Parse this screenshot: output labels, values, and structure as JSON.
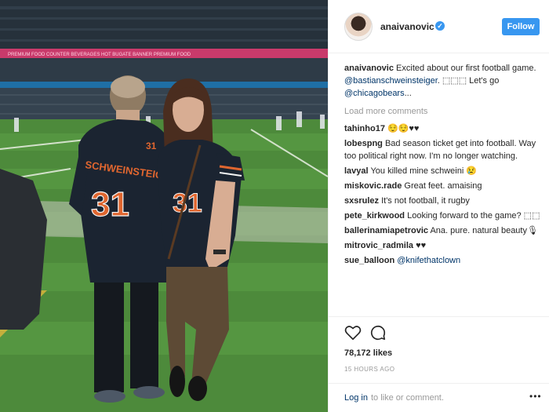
{
  "post": {
    "username": "anaivanovic",
    "follow_label": "Follow",
    "caption": {
      "user": "anaivanovic",
      "text": " Excited about our first football game. ",
      "mention1": "@bastianschweinsteiger",
      "text2": ". ⬚⬚⬚ Let's go ",
      "mention2": "@chicagobears",
      "text3": "..."
    },
    "load_more": "Load more comments",
    "comments": [
      {
        "user": "tahinho17",
        "text": " 😌😌♥♥"
      },
      {
        "user": "lobespng",
        "text": " Bad season ticket get into football. Way too political right now. I'm no longer watching."
      },
      {
        "user": "lavyal",
        "text": " You killed mine schweini 😢"
      },
      {
        "user": "miskovic.rade",
        "text": " Great feet. amaising"
      },
      {
        "user": "sxsrulez",
        "text": " It's not football, it rugby"
      },
      {
        "user": "pete_kirkwood",
        "text": " Looking forward to the game? ⬚⬚"
      },
      {
        "user": "ballerinamiapetrovic",
        "text": " Ana. pure. natural beauty🎙"
      },
      {
        "user": "mitrovic_radmila",
        "text": " ♥♥"
      },
      {
        "user": "sue_balloon",
        "text": " ",
        "mention": "@knifethatclown"
      }
    ],
    "likes": "78,172 likes",
    "timestamp": "15 HOURS AGO",
    "login_link": "Log in",
    "login_rest": " to like or comment.",
    "more": "•••"
  },
  "photo": {
    "jersey_name": "SCHWEINSTEIGER",
    "jersey_number": "31",
    "banner_text": "PREMIUM FOOD COUNTER  BEVERAGES  HOT BUGATE BANNER  PREMIUM FOOD"
  },
  "colors": {
    "accent": "#3897f0",
    "link": "#003569",
    "jersey_navy": "#1b2431",
    "jersey_orange": "#e0662f"
  }
}
